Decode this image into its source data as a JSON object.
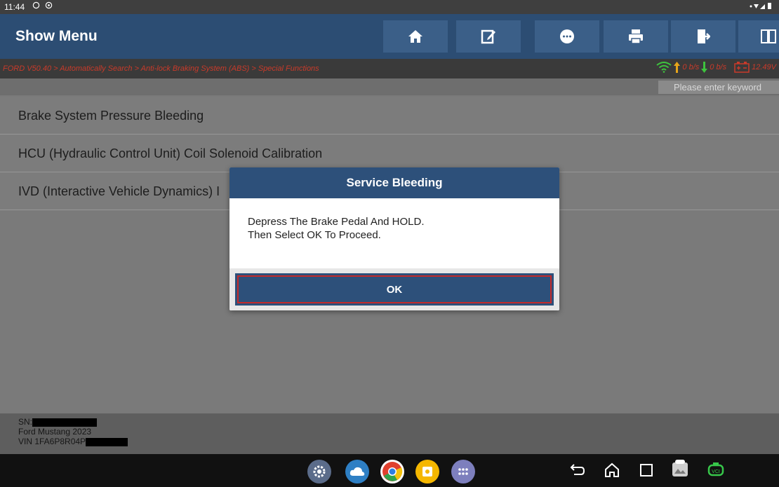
{
  "status_bar": {
    "time": "11:44"
  },
  "header": {
    "title": "Show Menu"
  },
  "breadcrumb": {
    "text": "FORD V50.40 > Automatically Search > Anti-lock Braking System (ABS) > Special Functions"
  },
  "network": {
    "upload": "0 b/s",
    "download": "0 b/s",
    "voltage": "12.49V"
  },
  "search": {
    "placeholder": "Please enter keyword"
  },
  "list": {
    "items": [
      {
        "label": "Brake System Pressure Bleeding"
      },
      {
        "label": "HCU (Hydraulic Control Unit) Coil Solenoid Calibration"
      },
      {
        "label": "IVD (Interactive Vehicle Dynamics) I"
      }
    ]
  },
  "footer": {
    "sn_label": "SN:",
    "vehicle": "Ford Mustang 2023",
    "vin_label": "VIN 1FA6P8R04P"
  },
  "modal": {
    "title": "Service Bleeding",
    "line1": "Depress The Brake Pedal And HOLD.",
    "line2": "Then Select OK To Proceed.",
    "ok_label": "OK"
  },
  "colors": {
    "header": "#2c4d73",
    "accent_red": "#c93a2a",
    "modal_blue": "#2d507a"
  }
}
